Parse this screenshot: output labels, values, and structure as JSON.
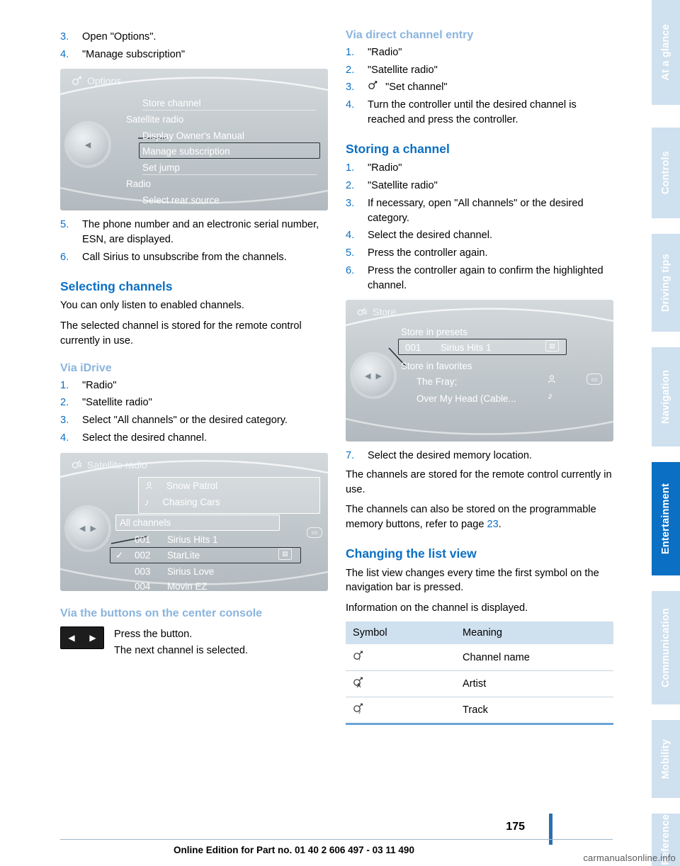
{
  "page": {
    "number": "175",
    "footer": "Online Edition for Part no. 01 40 2 606 497 - 03 11 490",
    "watermark": "carmanualsonline.info"
  },
  "tabs": [
    {
      "label": "At a glance",
      "active": false
    },
    {
      "label": "Controls",
      "active": false
    },
    {
      "label": "Driving tips",
      "active": false
    },
    {
      "label": "Navigation",
      "active": false
    },
    {
      "label": "Entertainment",
      "active": true
    },
    {
      "label": "Communication",
      "active": false
    },
    {
      "label": "Mobility",
      "active": false
    },
    {
      "label": "Reference",
      "active": false
    }
  ],
  "left": {
    "steps_top": [
      {
        "num": "3.",
        "text": "Open \"Options\"."
      },
      {
        "num": "4.",
        "text": "\"Manage subscription\""
      }
    ],
    "screen_options": {
      "title": "Options",
      "title_icon": "satellite-icon",
      "items": [
        "Store channel",
        "Satellite radio",
        "Display Owner's Manual",
        "Manage subscription",
        "Set jump",
        "Radio",
        "Select rear source"
      ],
      "highlighted": "Manage subscription"
    },
    "steps_mid": [
      {
        "num": "5.",
        "text": "The phone number and an electronic serial number, ESN, are displayed."
      },
      {
        "num": "6.",
        "text": "Call Sirius to unsubscribe from the channels."
      }
    ],
    "heading_selecting": "Selecting channels",
    "para1": "You can only listen to enabled channels.",
    "para2": "The selected channel is stored for the remote control currently in use.",
    "subhead_idrive": "Via iDrive",
    "steps_idrive": [
      {
        "num": "1.",
        "text": "\"Radio\""
      },
      {
        "num": "2.",
        "text": "\"Satellite radio\""
      },
      {
        "num": "3.",
        "text": "Select \"All channels\" or the desired category."
      },
      {
        "num": "4.",
        "text": "Select the desired channel."
      }
    ],
    "screen_satellite": {
      "title": "Satellite radio",
      "title_icon": "satellite-list-icon",
      "fav1": {
        "icon": "artist-icon",
        "text": "Snow Patrol"
      },
      "fav2": {
        "icon": "track-icon",
        "text": "Chasing Cars"
      },
      "category": "All channels",
      "channels": [
        {
          "check": "",
          "num": "001",
          "name": "Sirius Hits 1",
          "badge": ""
        },
        {
          "check": "✓",
          "num": "002",
          "name": "StarLite",
          "badge": "▤"
        },
        {
          "check": "",
          "num": "003",
          "name": "Sirius Love",
          "badge": ""
        },
        {
          "check": "",
          "num": "004",
          "name": "Movin EZ",
          "badge": ""
        }
      ]
    },
    "subhead_buttons": "Via the buttons on the center console",
    "button_graphic": {
      "left": "◀",
      "right": "▶"
    },
    "button_text1": "Press the button.",
    "button_text2": "The next channel is selected."
  },
  "right": {
    "subhead_direct": "Via direct channel entry",
    "steps_direct": [
      {
        "num": "1.",
        "text": "\"Radio\""
      },
      {
        "num": "2.",
        "text": "\"Satellite radio\""
      },
      {
        "num": "3.",
        "text": "\"Set channel\"",
        "icon": "set-channel-icon"
      },
      {
        "num": "4.",
        "text": "Turn the controller until the desired channel is reached and press the controller."
      }
    ],
    "heading_storing": "Storing a channel",
    "steps_storing": [
      {
        "num": "1.",
        "text": "\"Radio\""
      },
      {
        "num": "2.",
        "text": "\"Satellite radio\""
      },
      {
        "num": "3.",
        "text": "If necessary, open \"All channels\" or the desired category."
      },
      {
        "num": "4.",
        "text": "Select the desired channel."
      },
      {
        "num": "5.",
        "text": "Press the controller again."
      },
      {
        "num": "6.",
        "text": "Press the controller again to confirm the highlighted channel."
      }
    ],
    "screen_store": {
      "title": "Store",
      "title_icon": "store-icon",
      "section1": "Store in presets",
      "preset": {
        "num": "001",
        "name": "Sirius Hits 1",
        "badge": "▤"
      },
      "section2": "Store in favorites",
      "fav1": {
        "text": "The Fray;",
        "badge": "⚹"
      },
      "fav2": {
        "text": "Over My Head (Cable...",
        "badge": "♪"
      }
    },
    "step7": {
      "num": "7.",
      "text": "Select the desired memory location."
    },
    "para1": "The channels are stored for the remote control currently in use.",
    "para2_a": "The channels can also be stored on the programmable memory buttons, refer to page ",
    "para2_ref": "23",
    "para2_b": ".",
    "heading_listview": "Changing the list view",
    "para3": "The list view changes every time the first symbol on the navigation bar is pressed.",
    "para4": "Information on the channel is displayed.",
    "table": {
      "headers": [
        "Symbol",
        "Meaning"
      ],
      "rows": [
        {
          "symbol_icon": "channel-name-icon",
          "meaning": "Channel name"
        },
        {
          "symbol_icon": "artist-icon",
          "meaning": "Artist"
        },
        {
          "symbol_icon": "track-icon",
          "meaning": "Track"
        }
      ]
    }
  }
}
